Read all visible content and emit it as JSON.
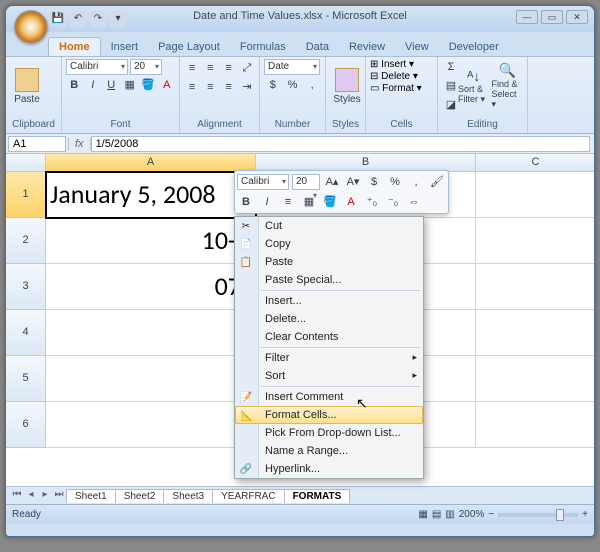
{
  "title": "Date and Time Values.xlsx - Microsoft Excel",
  "qat": {
    "save": "💾",
    "undo": "↶",
    "redo": "↷",
    "more": "▾"
  },
  "tabs": [
    "Home",
    "Insert",
    "Page Layout",
    "Formulas",
    "Data",
    "Review",
    "View",
    "Developer"
  ],
  "active_tab": "Home",
  "ribbon": {
    "clipboard": {
      "paste": "Paste",
      "label": "Clipboard"
    },
    "font": {
      "name": "Calibri",
      "size": "20",
      "bold": "B",
      "italic": "I",
      "underline": "U",
      "border": "▦",
      "fill": "🪣",
      "color": "A",
      "label": "Font"
    },
    "alignment": {
      "label": "Alignment"
    },
    "number": {
      "format": "Date",
      "currency": "$",
      "percent": "%",
      "comma": ",",
      "inc": "⁺₀",
      "dec": "⁻₀",
      "label": "Number"
    },
    "styles": {
      "btn": "Styles",
      "label": "Styles"
    },
    "cells": {
      "insert": "Insert",
      "delete": "Delete",
      "format": "Format",
      "label": "Cells"
    },
    "editing": {
      "sort": "Sort & Filter ▾",
      "find": "Find & Select ▾",
      "label": "Editing"
    }
  },
  "namebox": "A1",
  "formula": "1/5/2008",
  "columns": [
    "A",
    "B",
    "C"
  ],
  "rows": [
    "1",
    "2",
    "3",
    "4",
    "5",
    "6"
  ],
  "cells": {
    "A1": "January 5, 2008",
    "A2": "10-A",
    "A3": "07/"
  },
  "mini": {
    "font": "Calibri",
    "size": "20",
    "grow": "A▴",
    "shrink": "A▾",
    "cur": "$",
    "pct": "%",
    "comma": ",",
    "paint": "🖌",
    "bold": "B",
    "italic": "I",
    "center": "≡",
    "border": "▦",
    "fill": "🪣",
    "color": "A",
    "dec1": "⁺₀",
    "dec2": "⁻₀",
    "merge": "⇔"
  },
  "ctx": {
    "cut": "Cut",
    "copy": "Copy",
    "paste": "Paste",
    "pspecial": "Paste Special...",
    "insert": "Insert...",
    "delete": "Delete...",
    "clear": "Clear Contents",
    "filter": "Filter",
    "sort": "Sort",
    "comment": "Insert Comment",
    "format": "Format Cells...",
    "pick": "Pick From Drop-down List...",
    "range": "Name a Range...",
    "link": "Hyperlink..."
  },
  "sheet_tabs": [
    "Sheet1",
    "Sheet2",
    "Sheet3",
    "YEARFRAC",
    "FORMATS"
  ],
  "active_sheet": "FORMATS",
  "status": {
    "ready": "Ready",
    "zoom": "200%"
  }
}
